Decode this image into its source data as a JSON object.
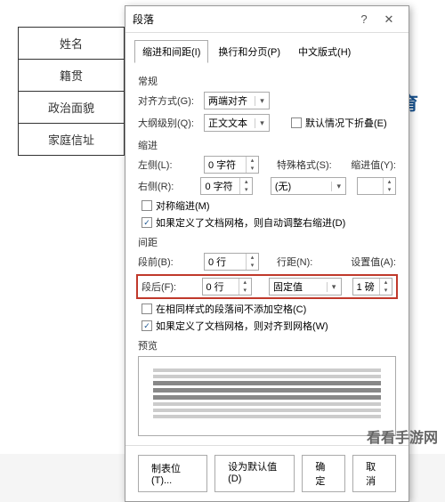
{
  "bg": {
    "cells": [
      "姓名",
      "籍贯",
      "政治面貌",
      "家庭信址"
    ],
    "right1": "",
    "right2": "育"
  },
  "dialog": {
    "title": "段落",
    "tabs": [
      "缩进和间距(I)",
      "换行和分页(P)",
      "中文版式(H)"
    ],
    "section_general": "常规",
    "alignment_label": "对齐方式(G):",
    "alignment_value": "两端对齐",
    "outline_label": "大纲级别(Q):",
    "outline_value": "正文文本",
    "collapse_chk": "默认情况下折叠(E)",
    "section_indent": "缩进",
    "indent_left_label": "左侧(L):",
    "indent_left_value": "0 字符",
    "indent_right_label": "右侧(R):",
    "indent_right_value": "0 字符",
    "special_label": "特殊格式(S):",
    "special_value": "(无)",
    "indent_by_label": "缩进值(Y):",
    "mirror_chk": "对称缩进(M)",
    "auto_indent_chk": "如果定义了文档网格，则自动调整右缩进(D)",
    "section_spacing": "间距",
    "space_before_label": "段前(B):",
    "space_before_value": "0 行",
    "space_after_label": "段后(F):",
    "space_after_value": "0 行",
    "line_spacing_label": "行距(N):",
    "line_spacing_value": "固定值",
    "set_value_label": "设置值(A):",
    "set_value_value": "1 磅",
    "no_space_chk": "在相同样式的段落间不添加空格(C)",
    "snap_grid_chk": "如果定义了文档网格，则对齐到网格(W)",
    "preview_label": "预览",
    "footer": {
      "tabs_btn": "制表位(T)...",
      "default_btn": "设为默认值(D)",
      "ok_btn": "确定",
      "cancel_btn": "取消"
    }
  },
  "watermark": "看看手游网"
}
